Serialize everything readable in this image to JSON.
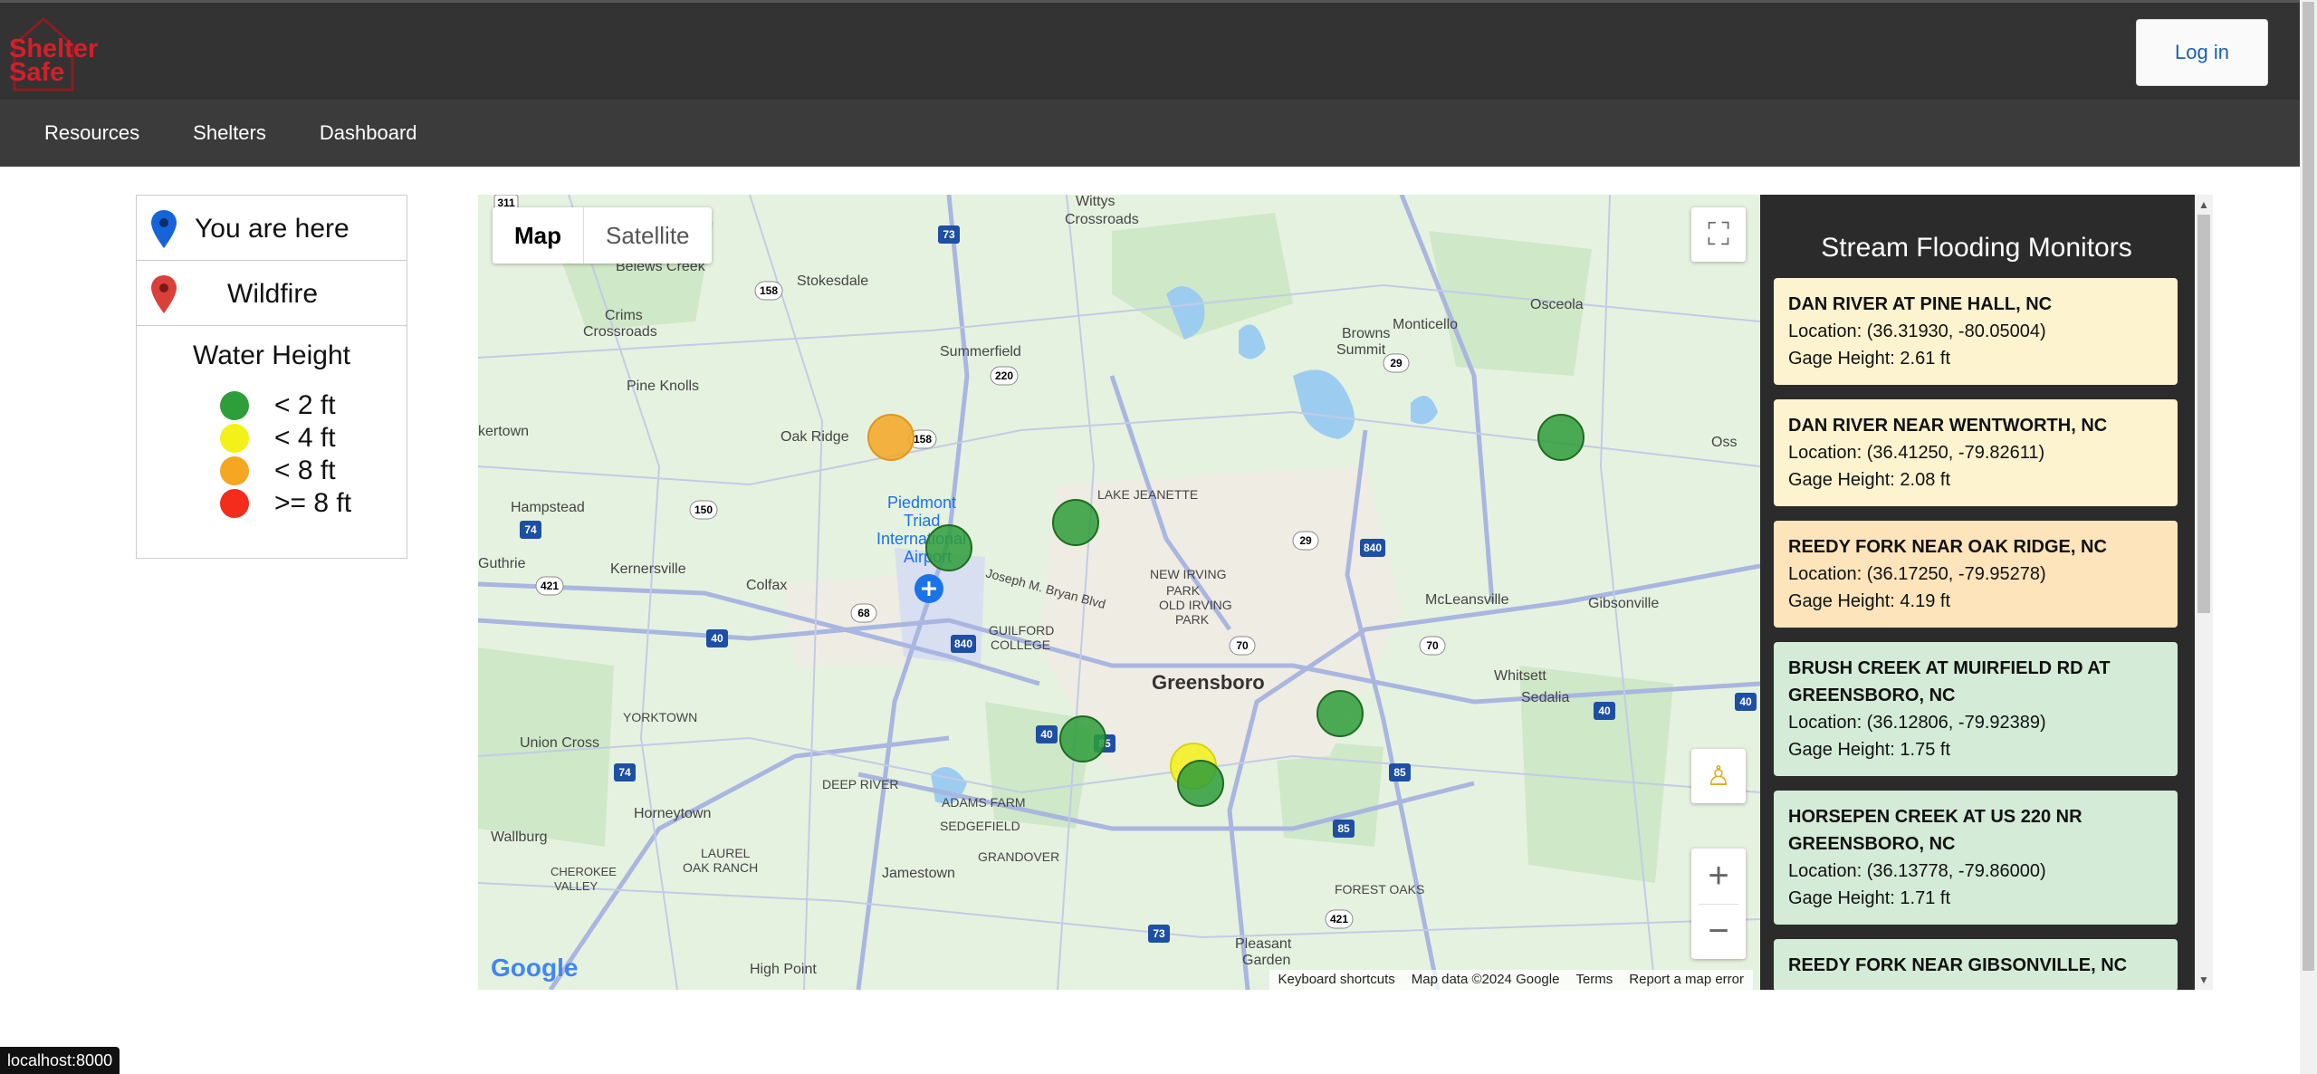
{
  "app": {
    "logo_text_1": "Shelter",
    "logo_text_2": "Safe",
    "login_label": "Log in"
  },
  "nav": [
    {
      "label": "Resources"
    },
    {
      "label": "Shelters"
    },
    {
      "label": "Dashboard"
    }
  ],
  "legend": {
    "you_are_here": "You are here",
    "wildfire": "Wildfire",
    "water_height_title": "Water Height",
    "levels": [
      {
        "label": "< 2 ft",
        "color": "#2e9e3a"
      },
      {
        "label": "< 4 ft",
        "color": "#f4f11a"
      },
      {
        "label": "< 8 ft",
        "color": "#f5a623"
      },
      {
        "label": ">= 8 ft",
        "color": "#f42c1c"
      }
    ],
    "you_pin_color": "#1565d8",
    "wildfire_pin_color": "#d9403a"
  },
  "map": {
    "type_map": "Map",
    "type_satellite": "Satellite",
    "places": {
      "wittys": "Wittys",
      "crossroads": "Crossroads",
      "belews_creek": "Belews Creek",
      "stokesdale": "Stokesdale",
      "crims": "Crims",
      "crims2": "Crossroads",
      "summerfield": "Summerfield",
      "browns": "Browns",
      "summit": "Summit",
      "monticello": "Monticello",
      "osceola": "Osceola",
      "pine_knolls": "Pine Knolls",
      "kertown": "kertown",
      "oak_ridge": "Oak Ridge",
      "lake_jeanette": "LAKE JEANETTE",
      "hampstead": "Hampstead",
      "piedmont": "Piedmont",
      "triad": "Triad",
      "international": "International",
      "airport": "Airport",
      "new_irving": "NEW IRVING",
      "park": "PARK",
      "old_irving": "OLD IRVING",
      "park2": "PARK",
      "guthrie": "Guthrie",
      "kernersville": "Kernersville",
      "colfax": "Colfax",
      "guilford": "GUILFORD",
      "college": "COLLEGE",
      "mcleansville": "McLeansville",
      "gibsonville": "Gibsonville",
      "greensboro": "Greensboro",
      "whitsett": "Whitsett",
      "sedalia": "Sedalia",
      "yorktown": "YORKTOWN",
      "union_cross": "Union Cross",
      "deep_river": "DEEP RIVER",
      "adams_farm": "ADAMS FARM",
      "horneytown": "Horneytown",
      "sedgefield": "SEDGEFIELD",
      "grandover": "GRANDOVER",
      "wallburg": "Wallburg",
      "jamestown": "Jamestown",
      "cherokee": "CHEROKEE",
      "valley": "VALLEY",
      "laurel": "LAUREL",
      "oak_ranch": "OAK RANCH",
      "forest_oaks": "FOREST OAKS",
      "pleasant": "Pleasant",
      "garden": "Garden",
      "high_point": "High Point",
      "bryan": "Joseph M. Bryan Blvd",
      "oss": "Oss"
    },
    "shields": [
      "311",
      "73",
      "158",
      "220",
      "150",
      "74",
      "421",
      "68",
      "40",
      "840",
      "29",
      "70",
      "85",
      "421",
      "158",
      "73",
      "40",
      "840",
      "40",
      "29",
      "85",
      "70",
      "85",
      "40",
      "74"
    ],
    "markers": [
      {
        "level": "< 8 ft",
        "color": "#f5a623"
      },
      {
        "level": "< 2 ft",
        "color": "#2e9e3a"
      },
      {
        "level": "< 2 ft",
        "color": "#2e9e3a"
      },
      {
        "level": "< 2 ft",
        "color": "#2e9e3a"
      },
      {
        "level": "< 2 ft",
        "color": "#2e9e3a"
      },
      {
        "level": "< 2 ft",
        "color": "#2e9e3a"
      },
      {
        "level": "< 4 ft",
        "color": "#f4f11a"
      },
      {
        "level": "< 2 ft",
        "color": "#2e9e3a"
      }
    ],
    "attribution": {
      "keyboard": "Keyboard shortcuts",
      "mapdata": "Map data ©2024 Google",
      "terms": "Terms",
      "report": "Report a map error"
    },
    "google": "Google"
  },
  "panel": {
    "title": "Stream Flooding Monitors",
    "cards": [
      {
        "name": "DAN RIVER AT PINE HALL, NC",
        "location": "Location: (36.31930, -80.05004)",
        "gage": "Gage Height: 2.61 ft",
        "bg": "#fdf3cf"
      },
      {
        "name": "DAN RIVER NEAR WENTWORTH, NC",
        "location": "Location: (36.41250, -79.82611)",
        "gage": "Gage Height: 2.08 ft",
        "bg": "#fdf3cf"
      },
      {
        "name": "REEDY FORK NEAR OAK RIDGE, NC",
        "location": "Location: (36.17250, -79.95278)",
        "gage": "Gage Height: 4.19 ft",
        "bg": "#fde4bb"
      },
      {
        "name": "BRUSH CREEK AT MUIRFIELD RD AT GREENSBORO, NC",
        "location": "Location: (36.12806, -79.92389)",
        "gage": "Gage Height: 1.75 ft",
        "bg": "#d3ebd7"
      },
      {
        "name": "HORSEPEN CREEK AT US 220 NR GREENSBORO, NC",
        "location": "Location: (36.13778, -79.86000)",
        "gage": "Gage Height: 1.71 ft",
        "bg": "#d3ebd7"
      },
      {
        "name": "REEDY FORK NEAR GIBSONVILLE, NC",
        "location": "",
        "gage": "",
        "bg": "#d3ebd7"
      }
    ]
  },
  "status": "localhost:8000"
}
